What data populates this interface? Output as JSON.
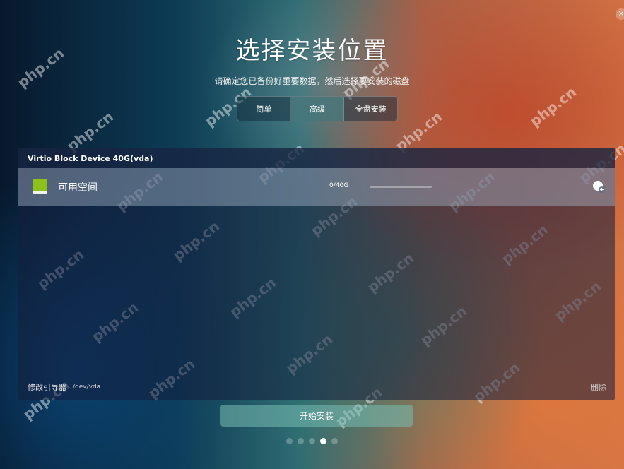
{
  "page": {
    "title": "选择安装位置",
    "subtitle": "请确定您已备份好重要数据，然后选择要安装的磁盘"
  },
  "mode_tabs": [
    {
      "label": "简单",
      "active": false
    },
    {
      "label": "高级",
      "active": true
    },
    {
      "label": "全盘安装",
      "active": false
    }
  ],
  "device": {
    "name": "Virtio Block Device 40G(vda)",
    "partitions": [
      {
        "label": "可用空间",
        "size": "0/40G",
        "usage_fraction": 0.0,
        "icon": "free-space-icon",
        "icon_color": "#8cc21b"
      }
    ],
    "add_partition_icon": "add-partition-icon"
  },
  "footer": {
    "bootloader_label": "修改引导器",
    "bootloader_path": "/dev/vda",
    "delete_label": "删除"
  },
  "install_button": {
    "label": "开始安装"
  },
  "step_dots": {
    "total": 5,
    "active_index": 3
  },
  "close_icon": {
    "glyph": "×"
  },
  "watermark": {
    "text": "php.cn"
  }
}
